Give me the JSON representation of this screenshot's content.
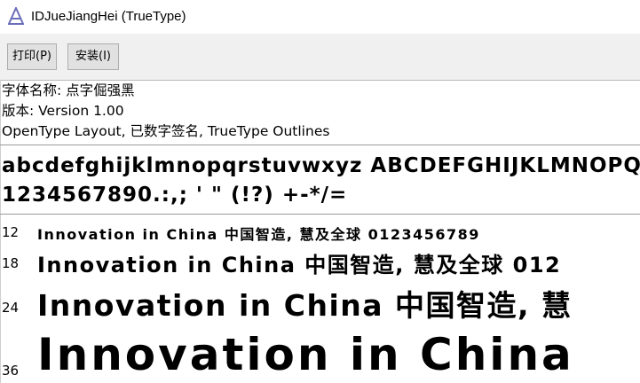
{
  "window": {
    "title": "IDJueJiangHei (TrueType)",
    "icon": "font-viewer-icon"
  },
  "toolbar": {
    "print_label": "打印(P)",
    "install_label": "安装(I)"
  },
  "info": {
    "font_name": "字体名称: 点字倔强黑",
    "version": "版本: Version 1.00",
    "features": "OpenType Layout, 已数字签名, TrueType Outlines"
  },
  "charset": {
    "line1": "abcdefghijklmnopqrstuvwxyz ABCDEFGHIJKLMNOPQ",
    "line2": "1234567890.:,; ' \" (!?) +-*/="
  },
  "samples": [
    {
      "size": "12",
      "text": "Innovation in China 中国智造, 慧及全球 0123456789"
    },
    {
      "size": "18",
      "text": "Innovation in China 中国智造, 慧及全球 012"
    },
    {
      "size": "24",
      "text": "Innovation in China 中国智造, 慧"
    },
    {
      "size": "36",
      "text": "Innovation in China"
    }
  ]
}
